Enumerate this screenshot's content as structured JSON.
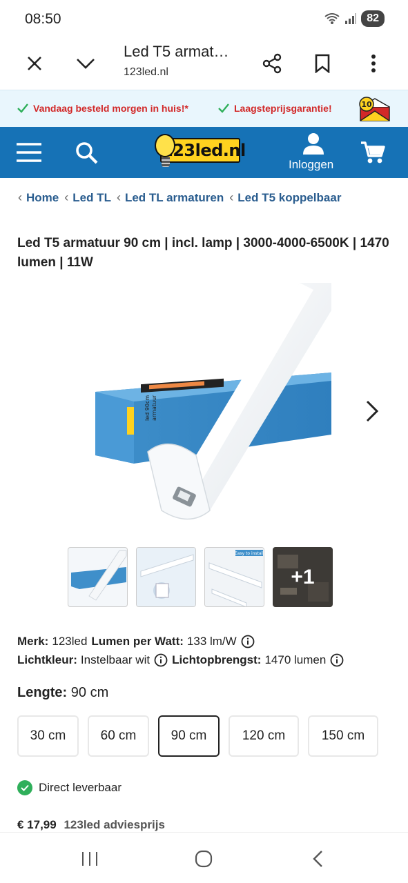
{
  "status_bar": {
    "time": "08:50",
    "battery": "82"
  },
  "browser": {
    "title": "Led T5 armat…",
    "url": "123led.nl"
  },
  "promo": {
    "item1": "Vandaag besteld morgen in huis!*",
    "item2": "Laagsteprijsgarantie!",
    "badge_number": "10"
  },
  "header": {
    "logo_text": "123led.nl",
    "login_label": "Inloggen"
  },
  "breadcrumb": [
    "Home",
    "Led TL",
    "Led TL armaturen",
    "Led T5 koppelbaar"
  ],
  "product": {
    "title": "Led T5 armatuur 90 cm | incl. lamp | 3000-4000-6500K | 1470 lumen | 11W",
    "box_text_1": "led 90cm",
    "box_text_2": "armatuur",
    "thumb_more": "+1",
    "thumb3_text": "Easy to install"
  },
  "specs": {
    "merk_label": "Merk:",
    "merk_value": "123led",
    "lpw_label": "Lumen per Watt:",
    "lpw_value": "133 lm/W",
    "kleur_label": "Lichtkleur:",
    "kleur_value": "Instelbaar wit",
    "opbrengst_label": "Lichtopbrengst:",
    "opbrengst_value": "1470 lumen"
  },
  "length": {
    "label": "Lengte:",
    "value": "90 cm",
    "options": [
      "30 cm",
      "60 cm",
      "90 cm",
      "120 cm",
      "150 cm"
    ],
    "selected": "90 cm"
  },
  "availability": "Direct leverbaar",
  "price": {
    "amount": "€ 17,99",
    "advice": "123led adviesprijs"
  },
  "colors": {
    "header_blue": "#1672b6",
    "promo_red": "#d22828",
    "check_green": "#2faf5a",
    "logo_yellow": "#ffd21f"
  }
}
